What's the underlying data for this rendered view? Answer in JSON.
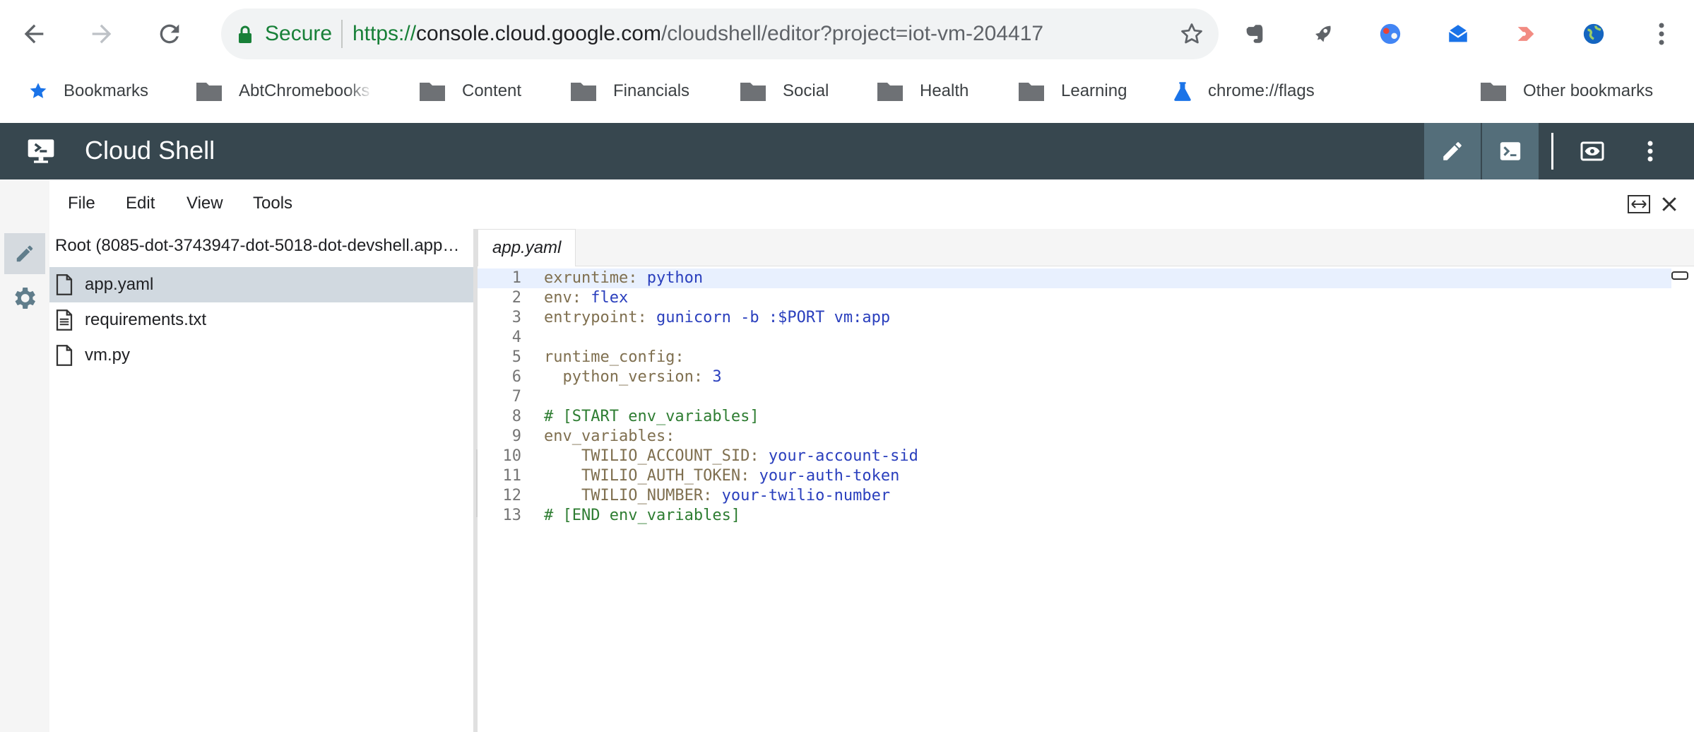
{
  "browser": {
    "secure_label": "Secure",
    "url_scheme": "https://",
    "url_host": "console.cloud.google.com",
    "url_path": "/cloudshell/editor?project=iot-vm-204417"
  },
  "bookmarks": {
    "items": [
      {
        "label": "Bookmarks",
        "icon": "star-icon"
      },
      {
        "label": "AbtChromebooks",
        "icon": "folder-icon"
      },
      {
        "label": "Content",
        "icon": "folder-icon"
      },
      {
        "label": "Financials",
        "icon": "folder-icon"
      },
      {
        "label": "Social",
        "icon": "folder-icon"
      },
      {
        "label": "Health",
        "icon": "folder-icon"
      },
      {
        "label": "Learning",
        "icon": "folder-icon"
      },
      {
        "label": "chrome://flags",
        "icon": "flask-icon"
      }
    ],
    "other": "Other bookmarks"
  },
  "cloudshell": {
    "title": "Cloud Shell"
  },
  "menu": {
    "file": "File",
    "edit": "Edit",
    "view": "View",
    "tools": "Tools"
  },
  "filetree": {
    "root": "Root (8085-dot-3743947-dot-5018-dot-devshell.appspot.com)",
    "files": [
      {
        "name": "app.yaml",
        "selected": true
      },
      {
        "name": "requirements.txt",
        "selected": false
      },
      {
        "name": "vm.py",
        "selected": false
      }
    ]
  },
  "editor": {
    "tab_label": "app.yaml",
    "lines": [
      {
        "n": "1",
        "key": "exruntime:",
        "val": " python"
      },
      {
        "n": "2",
        "key": "env:",
        "val": " flex"
      },
      {
        "n": "3",
        "key": "entrypoint:",
        "val": " gunicorn -b :$PORT vm:app"
      },
      {
        "n": "4",
        "key": "",
        "val": ""
      },
      {
        "n": "5",
        "key": "runtime_config:",
        "val": ""
      },
      {
        "n": "6",
        "key": "  python_version:",
        "val": " 3"
      },
      {
        "n": "7",
        "key": "",
        "val": ""
      },
      {
        "n": "8",
        "comment": "# [START env_variables]"
      },
      {
        "n": "9",
        "key": "env_variables:",
        "val": ""
      },
      {
        "n": "10",
        "key": "    TWILIO_ACCOUNT_SID:",
        "val": " your-account-sid"
      },
      {
        "n": "11",
        "key": "    TWILIO_AUTH_TOKEN:",
        "val": " your-auth-token"
      },
      {
        "n": "12",
        "key": "    TWILIO_NUMBER:",
        "val": " your-twilio-number"
      },
      {
        "n": "13",
        "comment": "# [END env_variables]"
      }
    ]
  },
  "colors": {
    "header_bg": "#37474f",
    "yaml_key": "#7f6f4f",
    "yaml_value": "#2a3fbd",
    "yaml_comment": "#2e7d32",
    "secure_green": "#188038"
  }
}
